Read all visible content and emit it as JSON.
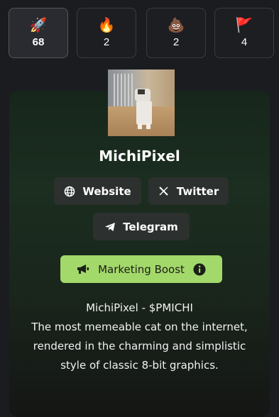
{
  "reactions": [
    {
      "emoji": "🚀",
      "icon": "rocket-icon",
      "count": "68",
      "active": true
    },
    {
      "emoji": "🔥",
      "icon": "fire-icon",
      "count": "2",
      "active": false
    },
    {
      "emoji": "💩",
      "icon": "poop-icon",
      "count": "2",
      "active": false
    },
    {
      "emoji": "🚩",
      "icon": "red-flag-icon",
      "count": "4",
      "active": false
    }
  ],
  "token": {
    "name": "MichiPixel",
    "links": {
      "website": "Website",
      "twitter": "Twitter",
      "telegram": "Telegram"
    },
    "boost_label": "Marketing Boost",
    "description_title": "MichiPixel - $PMICHI",
    "description": "The most memeable cat on the internet, rendered in the charming and simplistic style of classic 8-bit graphics."
  },
  "colors": {
    "background": "#1b1c1f",
    "boost_button": "#a3d86b",
    "link_button": "#2c302e",
    "card_gradient_top": "#17261b"
  }
}
